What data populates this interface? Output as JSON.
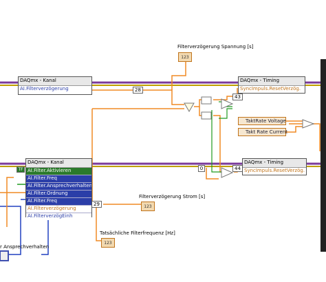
{
  "labels": {
    "filter_delay_voltage": "Filterverzögerung Spannung [s]",
    "filter_delay_current": "Filterverzögerung Strom [s]",
    "actual_filter_freq": "Tatsächliche Filterfrequenz [Hz]",
    "response_behavior": "r Ansprechverhalten"
  },
  "daqmx_channel_top": {
    "title": "DAQmx - Kanal",
    "rows": [
      "AI.Filterverzögerung"
    ]
  },
  "daqmx_channel_bottom": {
    "title": "DAQmx - Kanal",
    "rows": [
      "AI.Filter.Aktivieren",
      "AI.Filter.Freq",
      "AI.Filter.Ansprechverhalten",
      "AI.Filter.Ordnung",
      "AI.Filter.Freq",
      "AI.Filterverzögerung",
      "AI.FilterverzögEinh"
    ]
  },
  "daqmx_timing_top": {
    "title": "DAQmx - Timing",
    "rows": [
      "SyncImpuls.ResetVerzög."
    ]
  },
  "daqmx_timing_bottom": {
    "title": "DAQmx - Timing",
    "rows": [
      "SyncImpuls.ResetVerzög."
    ]
  },
  "properties": {
    "takt_voltage": "TaktRate Voltage",
    "takt_current": "Takt Rate Current"
  },
  "constants": {
    "c28": "28",
    "c29": "29",
    "c43": "43",
    "c44": "44",
    "c0": "0",
    "tf": "TF"
  },
  "indicators": {
    "i123": "123"
  },
  "colors": {
    "error_wire": "#c0a000",
    "task_wire": "#7a3a9a",
    "double_wire": "#f08a24",
    "bool_wire": "#1f9a1f",
    "int_wire": "#2040c0"
  }
}
